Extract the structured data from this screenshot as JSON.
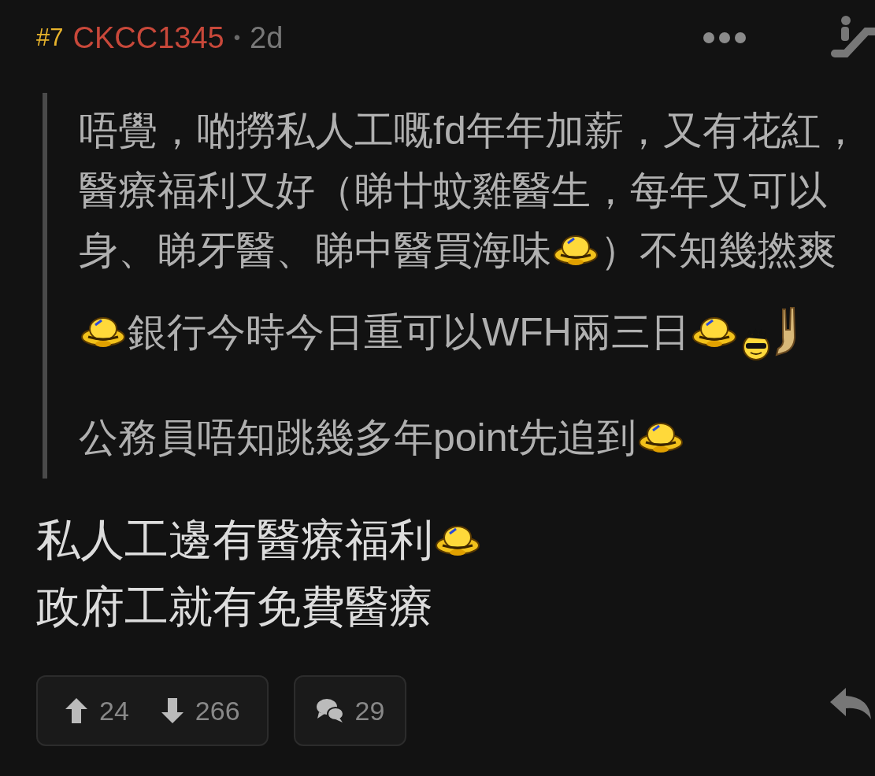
{
  "post": {
    "number": "#7",
    "author": "CKCC1345",
    "separator": "•",
    "age": "2d"
  },
  "quote": {
    "paragraphs": [
      [
        [
          {
            "kind": "text",
            "text": "唔覺，啲撈私人工嘅fd年年加薪，又有花紅，"
          }
        ],
        [
          {
            "kind": "text",
            "text": "醫療福利又好（睇廿蚊雞醫生，每年又可以"
          }
        ],
        [
          {
            "kind": "text",
            "text": "身、睇牙醫、睇中醫買海味"
          },
          {
            "kind": "laugh"
          },
          {
            "kind": "text",
            "text": "）不知幾撚爽"
          }
        ]
      ],
      [
        [
          {
            "kind": "laugh"
          },
          {
            "kind": "text",
            "text": "銀行今時今日重可以WFH兩三日"
          },
          {
            "kind": "laugh"
          },
          {
            "kind": "cool"
          }
        ]
      ],
      [
        [
          {
            "kind": "text",
            "text": "公務員唔知跳幾多年point先追到"
          },
          {
            "kind": "laugh"
          }
        ]
      ]
    ]
  },
  "body": [
    [
      {
        "kind": "text",
        "text": "私人工邊有醫療福利"
      },
      {
        "kind": "laugh"
      }
    ],
    [
      {
        "kind": "text",
        "text": "政府工就有免費醫療"
      }
    ]
  ],
  "actions": {
    "upvotes": "24",
    "downvotes": "266",
    "comments": "29"
  }
}
